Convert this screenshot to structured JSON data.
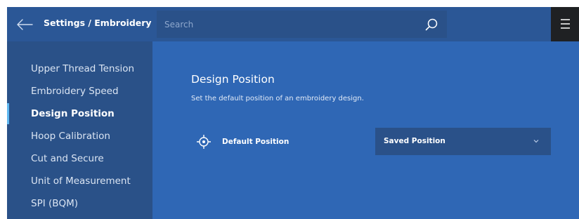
{
  "header": {
    "title": "Settings / Embroidery",
    "search_placeholder": "Search",
    "icons": {
      "back": "arrow-left-icon",
      "search": "search-icon",
      "menu": "hamburger-icon"
    }
  },
  "sidebar": {
    "items": [
      {
        "label": "Upper Thread Tension",
        "active": false
      },
      {
        "label": "Embroidery Speed",
        "active": false
      },
      {
        "label": "Design Position",
        "active": true
      },
      {
        "label": "Hoop Calibration",
        "active": false
      },
      {
        "label": "Cut and Secure",
        "active": false
      },
      {
        "label": "Unit of Measurement",
        "active": false
      },
      {
        "label": "SPI (BQM)",
        "active": false
      }
    ]
  },
  "main": {
    "title": "Design Position",
    "description": "Set the default position of an embroidery design.",
    "setting": {
      "icon": "crosshair-icon",
      "label": "Default Position",
      "value": "Saved Position"
    }
  },
  "colors": {
    "background": "#2f67b5",
    "sidebar": "#2a5188",
    "topbar": "#2b5796",
    "menu_button": "#1f2123",
    "active_indicator": "#5fb8f0"
  }
}
